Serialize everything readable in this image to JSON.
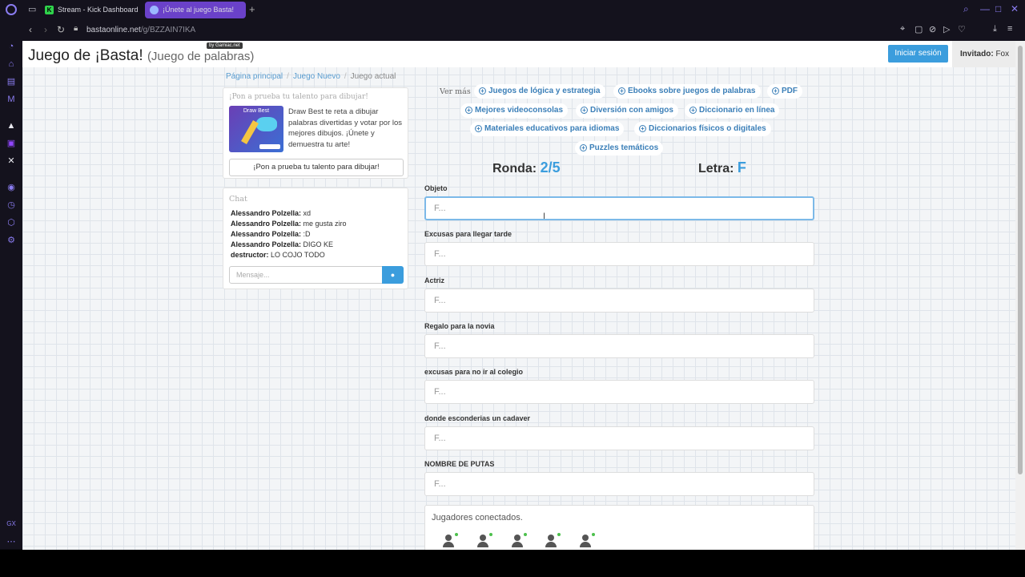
{
  "browser": {
    "tabs": [
      {
        "label": "Stream - Kick Dashboard",
        "favicon": "K"
      },
      {
        "label": "¡Únete al juego Basta!"
      }
    ],
    "url_host": "bastaonline.net",
    "url_path": "/g/BZZAIN7IKA",
    "sidebar_bottom_label": "GX",
    "accent_color": "#8a7cf0"
  },
  "page": {
    "title": "Juego de ¡Basta!",
    "subtitle": "(Juego de palabras)",
    "by_badge": "by Gamiac.net",
    "login_label": "Iniciar sesión",
    "guest_label": "Invitado:",
    "guest_name": "Fox",
    "breadcrumb": [
      "Página principal",
      "Juego Nuevo",
      "Juego actual"
    ]
  },
  "promo": {
    "title": "¡Pon a prueba tu talento para dibujar!",
    "image_label": "Draw Best",
    "text": "Draw Best te reta a dibujar palabras divertidas y votar por los mejores dibujos. ¡Únete y demuestra tu arte!",
    "button": "¡Pon a prueba tu talento para dibujar!"
  },
  "chat": {
    "title": "Chat",
    "messages": [
      {
        "user": "Alessandro Polzella:",
        "text": " xd"
      },
      {
        "user": "Alessandro Polzella:",
        "text": " me gusta ziro"
      },
      {
        "user": "Alessandro Polzella:",
        "text": " :D"
      },
      {
        "user": "Alessandro Polzella:",
        "text": " DIGO KE"
      },
      {
        "user": "destructor:",
        "text": " LO COJO TODO"
      }
    ],
    "placeholder": "Mensaje..."
  },
  "links": {
    "label": "Ver más",
    "items": [
      "Juegos de lógica y estrategia",
      "Ebooks sobre juegos de palabras",
      "PDF",
      "Mejores videoconsolas",
      "Diversión con amigos",
      "Diccionario en línea",
      "Materiales educativos para idiomas",
      "Diccionarios físicos o digitales",
      "Puzzles temáticos"
    ]
  },
  "game": {
    "round_label": "Ronda:",
    "round_value": "2/5",
    "letter_label": "Letra:",
    "letter_value": "F",
    "categories": [
      {
        "label": "Objeto",
        "placeholder": "F..."
      },
      {
        "label": "Excusas para llegar tarde",
        "placeholder": "F..."
      },
      {
        "label": "Actriz",
        "placeholder": "F..."
      },
      {
        "label": "Regalo para la novia",
        "placeholder": "F..."
      },
      {
        "label": "excusas para no ir al colegio",
        "placeholder": "F..."
      },
      {
        "label": "donde esconderias un cadaver",
        "placeholder": "F..."
      },
      {
        "label": "NOMBRE DE PUTAS",
        "placeholder": "F..."
      }
    ],
    "players_title": "Jugadores conectados.",
    "players_count": 5,
    "accent_color": "#3b9ddd"
  }
}
